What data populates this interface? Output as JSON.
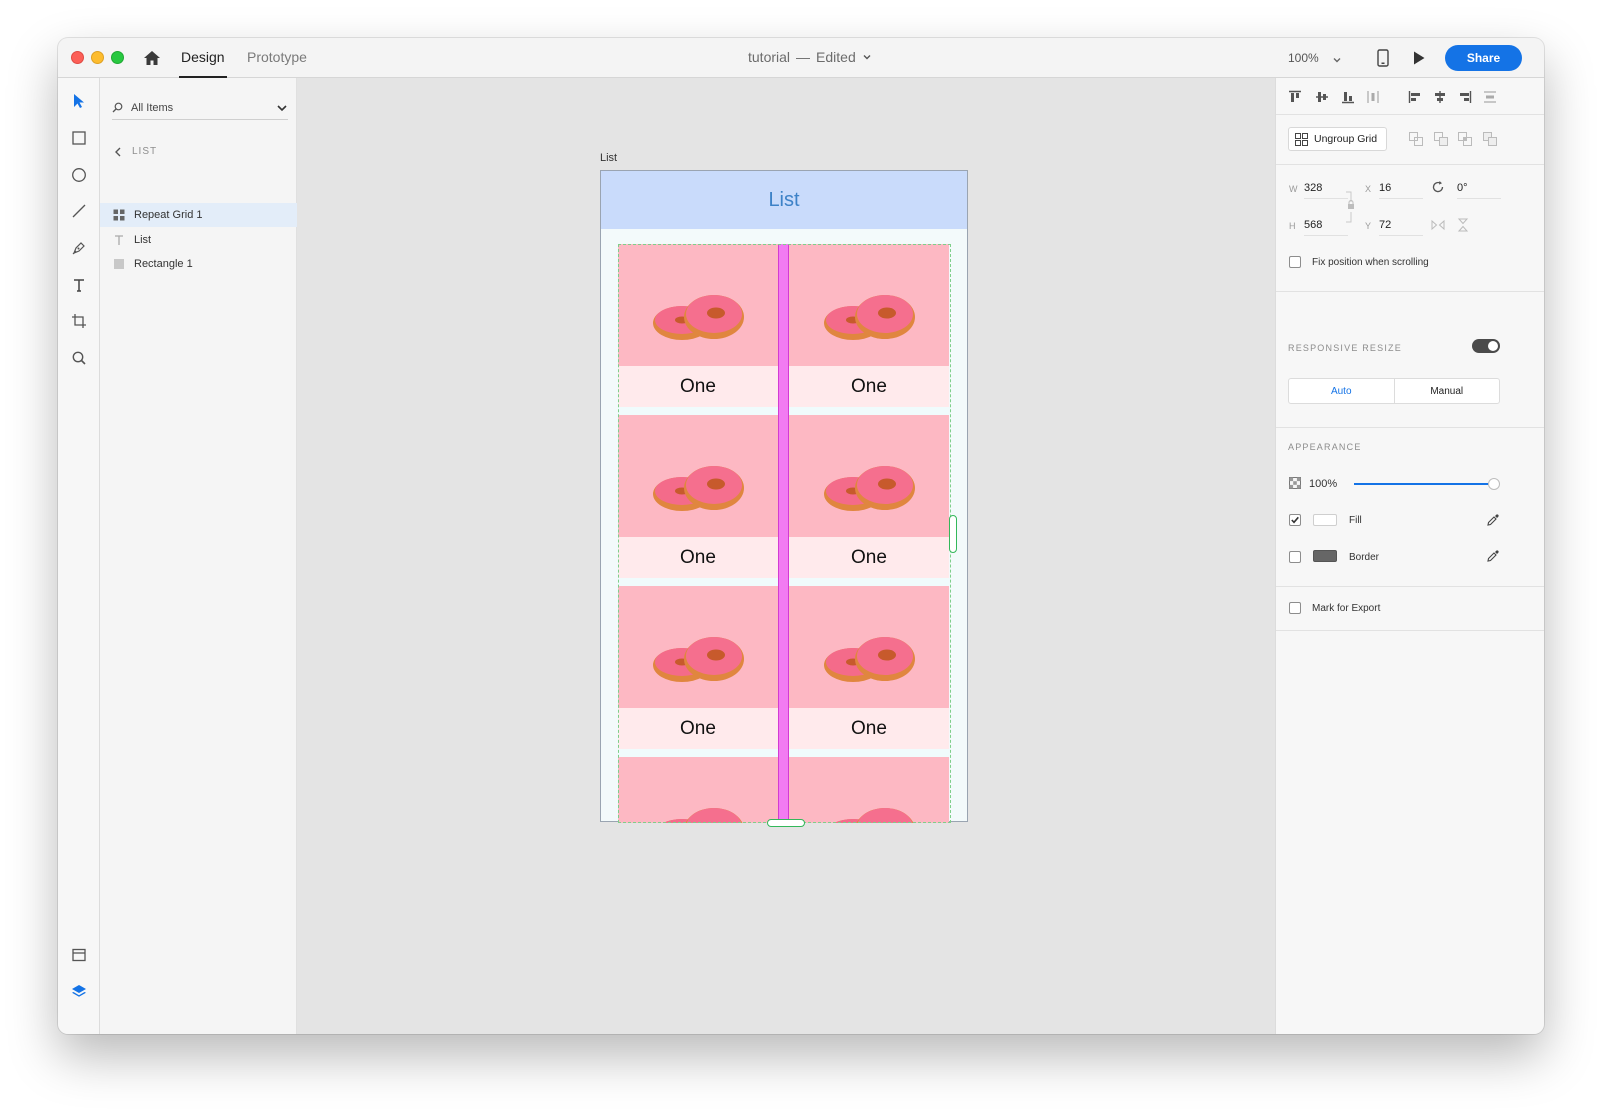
{
  "titlebar": {
    "tabs": [
      "Design",
      "Prototype"
    ],
    "doc_name": "tutorial",
    "separator": "—",
    "doc_status": "Edited",
    "zoom": "100%",
    "share_label": "Share"
  },
  "layers": {
    "search_placeholder": "All Items",
    "back_label": "LIST",
    "items": [
      {
        "label": "Repeat Grid 1",
        "icon": "repeat-grid-icon",
        "selected": true
      },
      {
        "label": "List",
        "icon": "text-icon",
        "selected": false
      },
      {
        "label": "Rectangle 1",
        "icon": "rectangle-icon",
        "selected": false
      }
    ]
  },
  "canvas": {
    "artboard_label": "List",
    "header_title": "List",
    "grid_captions": [
      "One",
      "One",
      "One",
      "One",
      "One",
      "One"
    ],
    "header_color": "#c9dbfb",
    "cell_image_color": "#fdb8c3",
    "caption_bg_color": "#ffeaec",
    "gap_guide_color": "#f27bf2"
  },
  "properties": {
    "ungroup_label": "Ungroup Grid",
    "w_label": "W",
    "w_value": "328",
    "h_label": "H",
    "h_value": "568",
    "x_label": "X",
    "x_value": "16",
    "y_label": "Y",
    "y_value": "72",
    "rotation": "0°",
    "fix_position_label": "Fix position when scrolling",
    "responsive_title": "RESPONSIVE RESIZE",
    "responsive_on": true,
    "resize_options": [
      "Auto",
      "Manual"
    ],
    "resize_selected": "Auto",
    "appearance_title": "APPEARANCE",
    "opacity": "100%",
    "fill_label": "Fill",
    "fill_checked": true,
    "border_label": "Border",
    "border_checked": false,
    "export_label": "Mark for Export",
    "accent_color": "#1473e6"
  }
}
